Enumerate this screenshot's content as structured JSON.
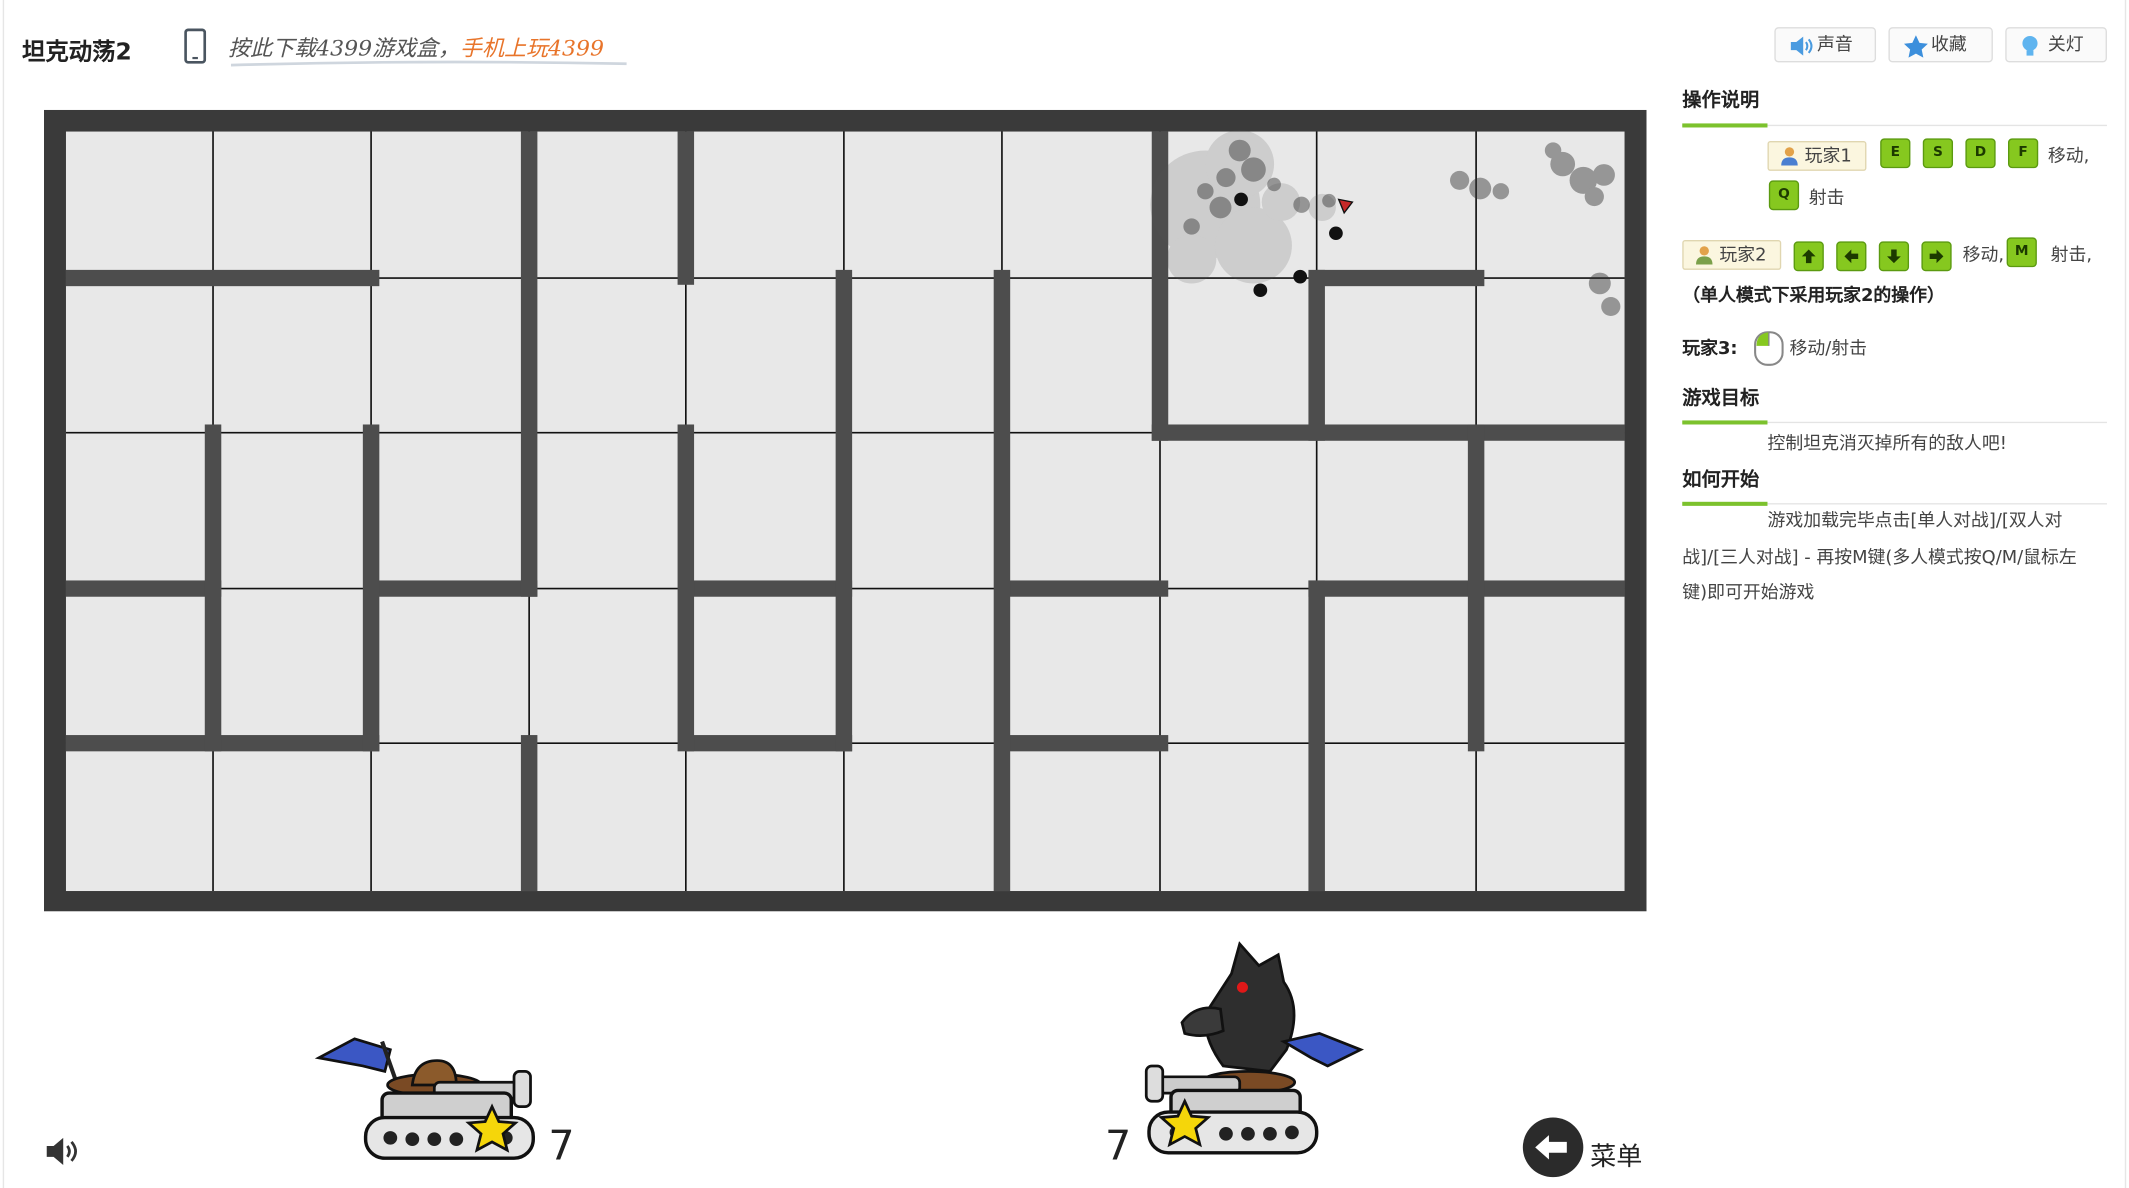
{
  "header": {
    "title": "坦克动荡2",
    "promo_text": "按此下载4399游戏盒，",
    "promo_highlight": "手机上玩4399",
    "buttons": {
      "sound": "声音",
      "favorite": "收藏",
      "lights": "关灯"
    }
  },
  "instructions": {
    "controls_title": "操作说明",
    "player1": {
      "label": "玩家1",
      "move_keys": [
        "E",
        "S",
        "D",
        "F"
      ],
      "move_text": "移动,",
      "shoot_key": "Q",
      "shoot_text": "射击"
    },
    "player2": {
      "label": "玩家2",
      "move_keys": [
        "up-arrow",
        "left-arrow",
        "down-arrow",
        "right-arrow"
      ],
      "move_text": "移动,",
      "shoot_key": "M",
      "shoot_text": "射击,"
    },
    "single_mode_note": "（单人模式下采用玩家2的操作）",
    "player3": {
      "label": "玩家3:",
      "text": "移动/射击"
    },
    "goal_title": "游戏目标",
    "goal_text": "控制坦克消灭掉所有的敌人吧!",
    "start_title": "如何开始",
    "start_text": "游戏加载完毕点击[单人对战]/[双人对战]/[三人对战] - 再按M键(多人模式按Q/M/鼠标左键)即可开始游戏"
  },
  "hud": {
    "player_score": "7",
    "enemy_score": "7",
    "menu_label": "菜单"
  },
  "colors": {
    "wall": "#4d4d4d",
    "floor": "#e8e8e8",
    "accent": "#7cc22d",
    "promo_highlight": "#e8742a"
  }
}
